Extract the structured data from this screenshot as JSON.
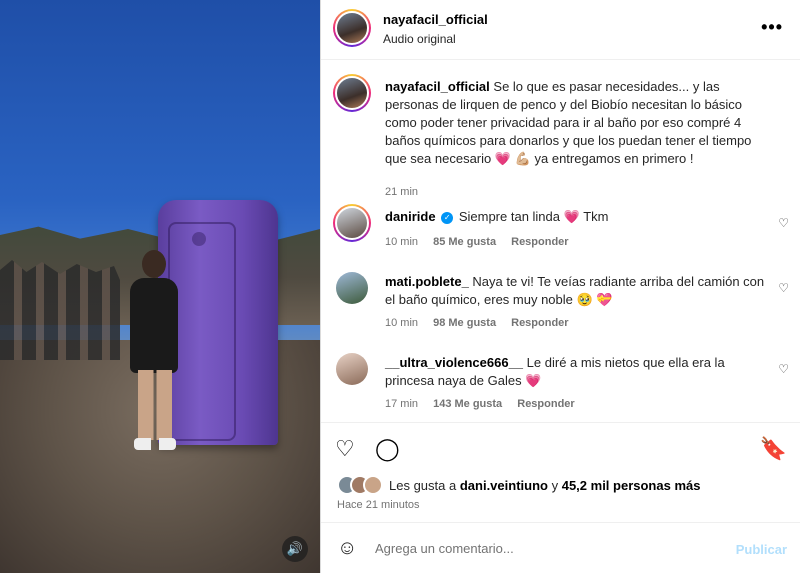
{
  "post": {
    "username": "nayafacil_official",
    "audio": "Audio original",
    "more_icon": "more-horizontal-icon"
  },
  "caption": {
    "username": "nayafacil_official",
    "text": "Se lo que es pasar necesidades... y las personas de lirquen de penco y del Biobío necesitan lo básico como poder tener privacidad para ir al baño por eso compré 4 baños químicos para donarlos y que los puedan tener el tiempo que sea necesario",
    "emojis": "💗 💪🏼",
    "text_end": "ya entregamos en primero !",
    "time": "21 min"
  },
  "comments": [
    {
      "username": "daniride",
      "verified": true,
      "text": "Siempre tan linda",
      "emoji": "💗",
      "text_end": "Tkm",
      "time": "10 min",
      "likes": "85 Me gusta",
      "reply": "Responder"
    },
    {
      "username": "mati.poblete_",
      "text": "Naya te vi! Te veías radiante arriba del camión con el baño químico, eres muy noble",
      "emoji": "🥹 💝",
      "time": "10 min",
      "likes": "98 Me gusta",
      "reply": "Responder"
    },
    {
      "username": "__ultra_violence666__",
      "text": "Le diré a mis nietos que ella era la princesa naya de Gales",
      "emoji": "💗",
      "time": "17 min",
      "likes": "143 Me gusta",
      "reply": "Responder"
    }
  ],
  "likes": {
    "prefix": "Les gusta a",
    "user": "dani.veintiuno",
    "connector": "y",
    "others": "45,2 mil personas más"
  },
  "time_ago": "Hace 21 minutos",
  "composer": {
    "placeholder": "Agrega un comentario...",
    "post_label": "Publicar"
  },
  "colors": {
    "accent": "#0095f6",
    "post_disabled": "#b2dffc",
    "heart": "#e0245e"
  }
}
